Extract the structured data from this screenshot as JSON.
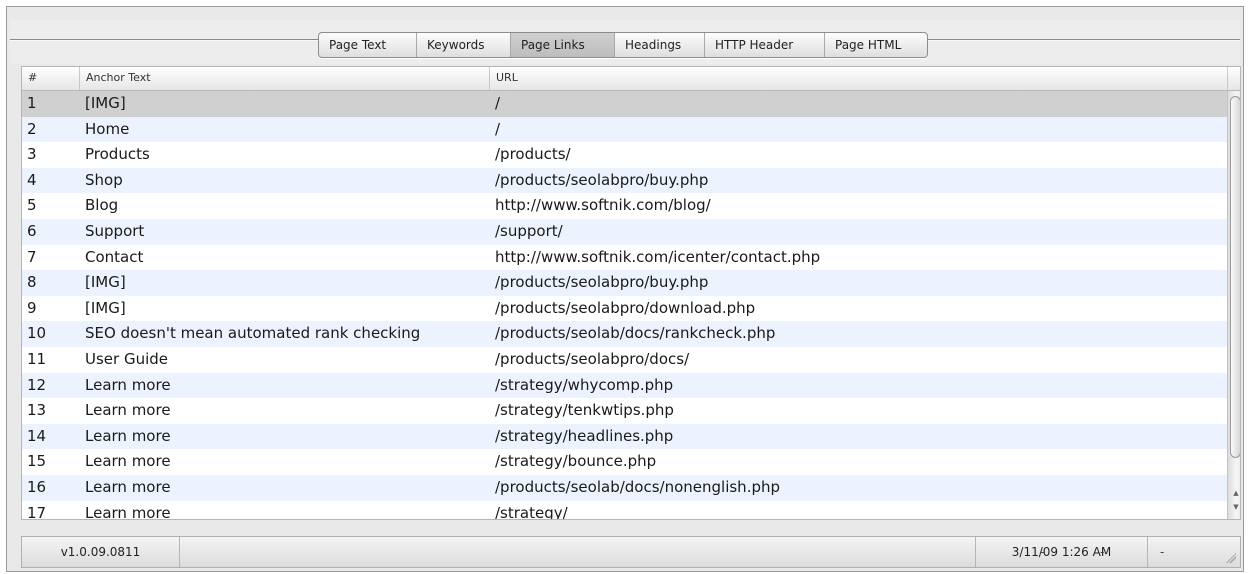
{
  "tabs": [
    {
      "label": "Page Text",
      "active": false
    },
    {
      "label": "Keywords",
      "active": false
    },
    {
      "label": "Page Links",
      "active": true
    },
    {
      "label": "Headings",
      "active": false
    },
    {
      "label": "HTTP Header",
      "active": false
    },
    {
      "label": "Page HTML",
      "active": false
    }
  ],
  "table": {
    "headers": {
      "num": "#",
      "anchor": "Anchor Text",
      "url": "URL"
    },
    "rows": [
      {
        "num": "1",
        "anchor": "[IMG]",
        "url": "/",
        "selected": true
      },
      {
        "num": "2",
        "anchor": "Home",
        "url": "/"
      },
      {
        "num": "3",
        "anchor": "Products",
        "url": "/products/"
      },
      {
        "num": "4",
        "anchor": "Shop",
        "url": "/products/seolabpro/buy.php"
      },
      {
        "num": "5",
        "anchor": "Blog",
        "url": "http://www.softnik.com/blog/"
      },
      {
        "num": "6",
        "anchor": "Support",
        "url": "/support/"
      },
      {
        "num": "7",
        "anchor": "Contact",
        "url": "http://www.softnik.com/icenter/contact.php"
      },
      {
        "num": "8",
        "anchor": "[IMG]",
        "url": "/products/seolabpro/buy.php"
      },
      {
        "num": "9",
        "anchor": "[IMG]",
        "url": "/products/seolabpro/download.php"
      },
      {
        "num": "10",
        "anchor": "SEO doesn't mean automated rank checking",
        "url": "/products/seolab/docs/rankcheck.php"
      },
      {
        "num": "11",
        "anchor": "User Guide",
        "url": "/products/seolabpro/docs/"
      },
      {
        "num": "12",
        "anchor": "Learn more",
        "url": "/strategy/whycomp.php"
      },
      {
        "num": "13",
        "anchor": "Learn more",
        "url": "/strategy/tenkwtips.php"
      },
      {
        "num": "14",
        "anchor": "Learn more",
        "url": "/strategy/headlines.php"
      },
      {
        "num": "15",
        "anchor": "Learn more",
        "url": "/strategy/bounce.php"
      },
      {
        "num": "16",
        "anchor": "Learn more",
        "url": "/products/seolab/docs/nonenglish.php"
      },
      {
        "num": "17",
        "anchor": "Learn more",
        "url": "/strategy/"
      }
    ]
  },
  "status": {
    "version": "v1.0.09.0811",
    "datetime": "3/11/09 1:26 AM",
    "dash1": "-",
    "dash2": "-",
    "dash3": "-"
  },
  "icons": {
    "scroll_up": "scroll-up-arrow-icon",
    "scroll_down": "scroll-down-arrow-icon",
    "resize_grip": "resize-grip-icon"
  }
}
